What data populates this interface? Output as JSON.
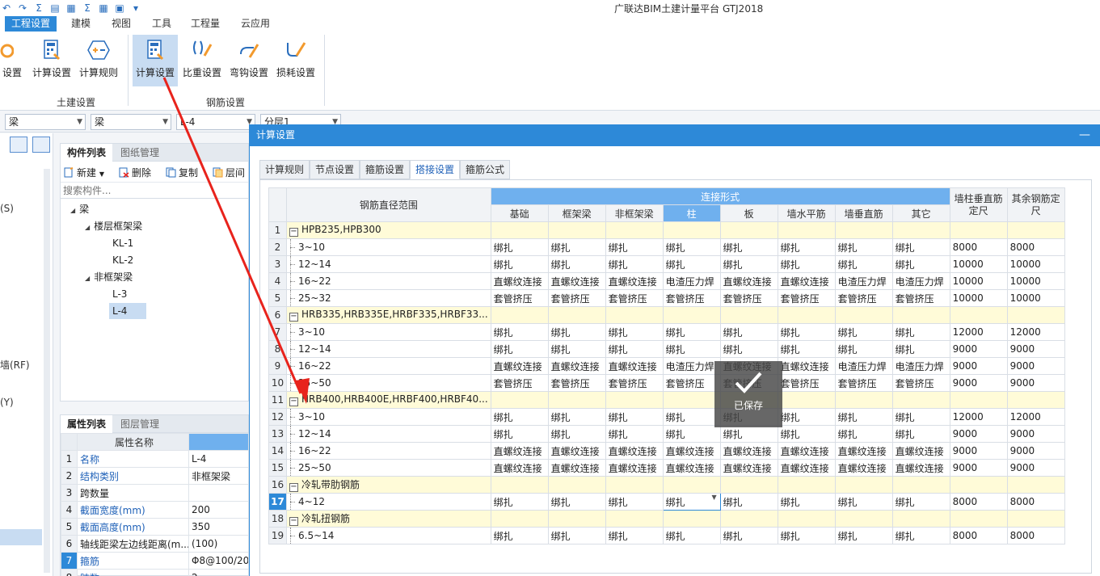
{
  "app_title": "广联达BIM土建计量平台 GTJ2018",
  "menu_tabs": [
    "工程设置",
    "建模",
    "视图",
    "工具",
    "工程量",
    "云应用"
  ],
  "ribbon": {
    "buttons": [
      "设置",
      "计算设置",
      "计算规则",
      "计算设置",
      "比重设置",
      "弯钩设置",
      "损耗设置"
    ],
    "groups": [
      "土建设置",
      "钢筋设置"
    ]
  },
  "filters": [
    "梁",
    "梁",
    "L-4",
    "分层1"
  ],
  "left_pane": [
    "(S)",
    "墙(RF)",
    "(Y)"
  ],
  "comp_panel": {
    "tabs": [
      "构件列表",
      "图纸管理"
    ],
    "tools": [
      "新建",
      "删除",
      "复制",
      "层间"
    ],
    "search_placeholder": "搜索构件...",
    "tree": {
      "root": "梁",
      "group1": "楼层框架梁",
      "g1_items": [
        "KL-1",
        "KL-2"
      ],
      "group2": "非框架梁",
      "g2_items": [
        "L-3",
        "L-4"
      ]
    }
  },
  "prop_panel": {
    "tabs": [
      "属性列表",
      "图层管理"
    ],
    "header": "属性名称",
    "rows": [
      {
        "n": "1",
        "name": "名称",
        "value": "L-4"
      },
      {
        "n": "2",
        "name": "结构类别",
        "value": "非框架梁"
      },
      {
        "n": "3",
        "name": "跨数量",
        "value": ""
      },
      {
        "n": "4",
        "name": "截面宽度(mm)",
        "value": "200"
      },
      {
        "n": "5",
        "name": "截面高度(mm)",
        "value": "350"
      },
      {
        "n": "6",
        "name": "轴线距梁左边线距离(m...",
        "value": "(100)"
      },
      {
        "n": "7",
        "name": "箍筋",
        "value": "Φ8@100/20"
      },
      {
        "n": "8",
        "name": "肢数",
        "value": "2"
      }
    ]
  },
  "dialog": {
    "title": "计算设置",
    "tabs": [
      "计算规则",
      "节点设置",
      "箍筋设置",
      "搭接设置",
      "箍筋公式"
    ],
    "grid": {
      "col_range": "钢筋直径范围",
      "col_group": "连接形式",
      "sub_cols": [
        "基础",
        "框架梁",
        "非框架梁",
        "柱",
        "板",
        "墙水平筋",
        "墙垂直筋",
        "其它"
      ],
      "col_wall": "墙柱垂直筋定尺",
      "col_other": "其余钢筋定尺",
      "rows": [
        {
          "n": "1",
          "group": true,
          "label": "HPB235,HPB300"
        },
        {
          "n": "2",
          "label": "3~10",
          "cells": [
            "绑扎",
            "绑扎",
            "绑扎",
            "绑扎",
            "绑扎",
            "绑扎",
            "绑扎",
            "绑扎",
            "8000",
            "8000"
          ]
        },
        {
          "n": "3",
          "label": "12~14",
          "cells": [
            "绑扎",
            "绑扎",
            "绑扎",
            "绑扎",
            "绑扎",
            "绑扎",
            "绑扎",
            "绑扎",
            "10000",
            "10000"
          ]
        },
        {
          "n": "4",
          "label": "16~22",
          "cells": [
            "直螺纹连接",
            "直螺纹连接",
            "直螺纹连接",
            "电渣压力焊",
            "直螺纹连接",
            "直螺纹连接",
            "电渣压力焊",
            "电渣压力焊",
            "10000",
            "10000"
          ]
        },
        {
          "n": "5",
          "label": "25~32",
          "cells": [
            "套管挤压",
            "套管挤压",
            "套管挤压",
            "套管挤压",
            "套管挤压",
            "套管挤压",
            "套管挤压",
            "套管挤压",
            "10000",
            "10000"
          ]
        },
        {
          "n": "6",
          "group": true,
          "label": "HRB335,HRB335E,HRBF335,HRBF33..."
        },
        {
          "n": "7",
          "label": "3~10",
          "cells": [
            "绑扎",
            "绑扎",
            "绑扎",
            "绑扎",
            "绑扎",
            "绑扎",
            "绑扎",
            "绑扎",
            "12000",
            "12000"
          ]
        },
        {
          "n": "8",
          "label": "12~14",
          "cells": [
            "绑扎",
            "绑扎",
            "绑扎",
            "绑扎",
            "绑扎",
            "绑扎",
            "绑扎",
            "绑扎",
            "9000",
            "9000"
          ]
        },
        {
          "n": "9",
          "label": "16~22",
          "cells": [
            "直螺纹连接",
            "直螺纹连接",
            "直螺纹连接",
            "电渣压力焊",
            "直螺纹连接",
            "直螺纹连接",
            "电渣压力焊",
            "电渣压力焊",
            "9000",
            "9000"
          ]
        },
        {
          "n": "10",
          "label": "25~50",
          "cells": [
            "套管挤压",
            "套管挤压",
            "套管挤压",
            "套管挤压",
            "套管挤压",
            "套管挤压",
            "套管挤压",
            "套管挤压",
            "9000",
            "9000"
          ]
        },
        {
          "n": "11",
          "group": true,
          "label": "HRB400,HRB400E,HRBF400,HRBF40..."
        },
        {
          "n": "12",
          "label": "3~10",
          "cells": [
            "绑扎",
            "绑扎",
            "绑扎",
            "绑扎",
            "绑扎",
            "绑扎",
            "绑扎",
            "绑扎",
            "12000",
            "12000"
          ]
        },
        {
          "n": "13",
          "label": "12~14",
          "cells": [
            "绑扎",
            "绑扎",
            "绑扎",
            "绑扎",
            "绑扎",
            "绑扎",
            "绑扎",
            "绑扎",
            "9000",
            "9000"
          ]
        },
        {
          "n": "14",
          "label": "16~22",
          "cells": [
            "直螺纹连接",
            "直螺纹连接",
            "直螺纹连接",
            "直螺纹连接",
            "直螺纹连接",
            "直螺纹连接",
            "直螺纹连接",
            "直螺纹连接",
            "9000",
            "9000"
          ]
        },
        {
          "n": "15",
          "label": "25~50",
          "cells": [
            "直螺纹连接",
            "直螺纹连接",
            "直螺纹连接",
            "直螺纹连接",
            "直螺纹连接",
            "直螺纹连接",
            "直螺纹连接",
            "直螺纹连接",
            "9000",
            "9000"
          ]
        },
        {
          "n": "16",
          "group": true,
          "label": "冷轧带肋钢筋"
        },
        {
          "n": "17",
          "label": "4~12",
          "current": true,
          "cells": [
            "绑扎",
            "绑扎",
            "绑扎",
            "绑扎",
            "绑扎",
            "绑扎",
            "绑扎",
            "绑扎",
            "8000",
            "8000"
          ]
        },
        {
          "n": "18",
          "group": true,
          "label": "冷轧扭钢筋"
        },
        {
          "n": "19",
          "label": "6.5~14",
          "cells": [
            "绑扎",
            "绑扎",
            "绑扎",
            "绑扎",
            "绑扎",
            "绑扎",
            "绑扎",
            "绑扎",
            "8000",
            "8000"
          ]
        }
      ]
    },
    "toast": "已保存"
  },
  "colors": {
    "accent": "#2d89d8",
    "header_blue": "#6fb0ee",
    "group_row": "#fffbd8",
    "arrow": "#e8231c"
  }
}
